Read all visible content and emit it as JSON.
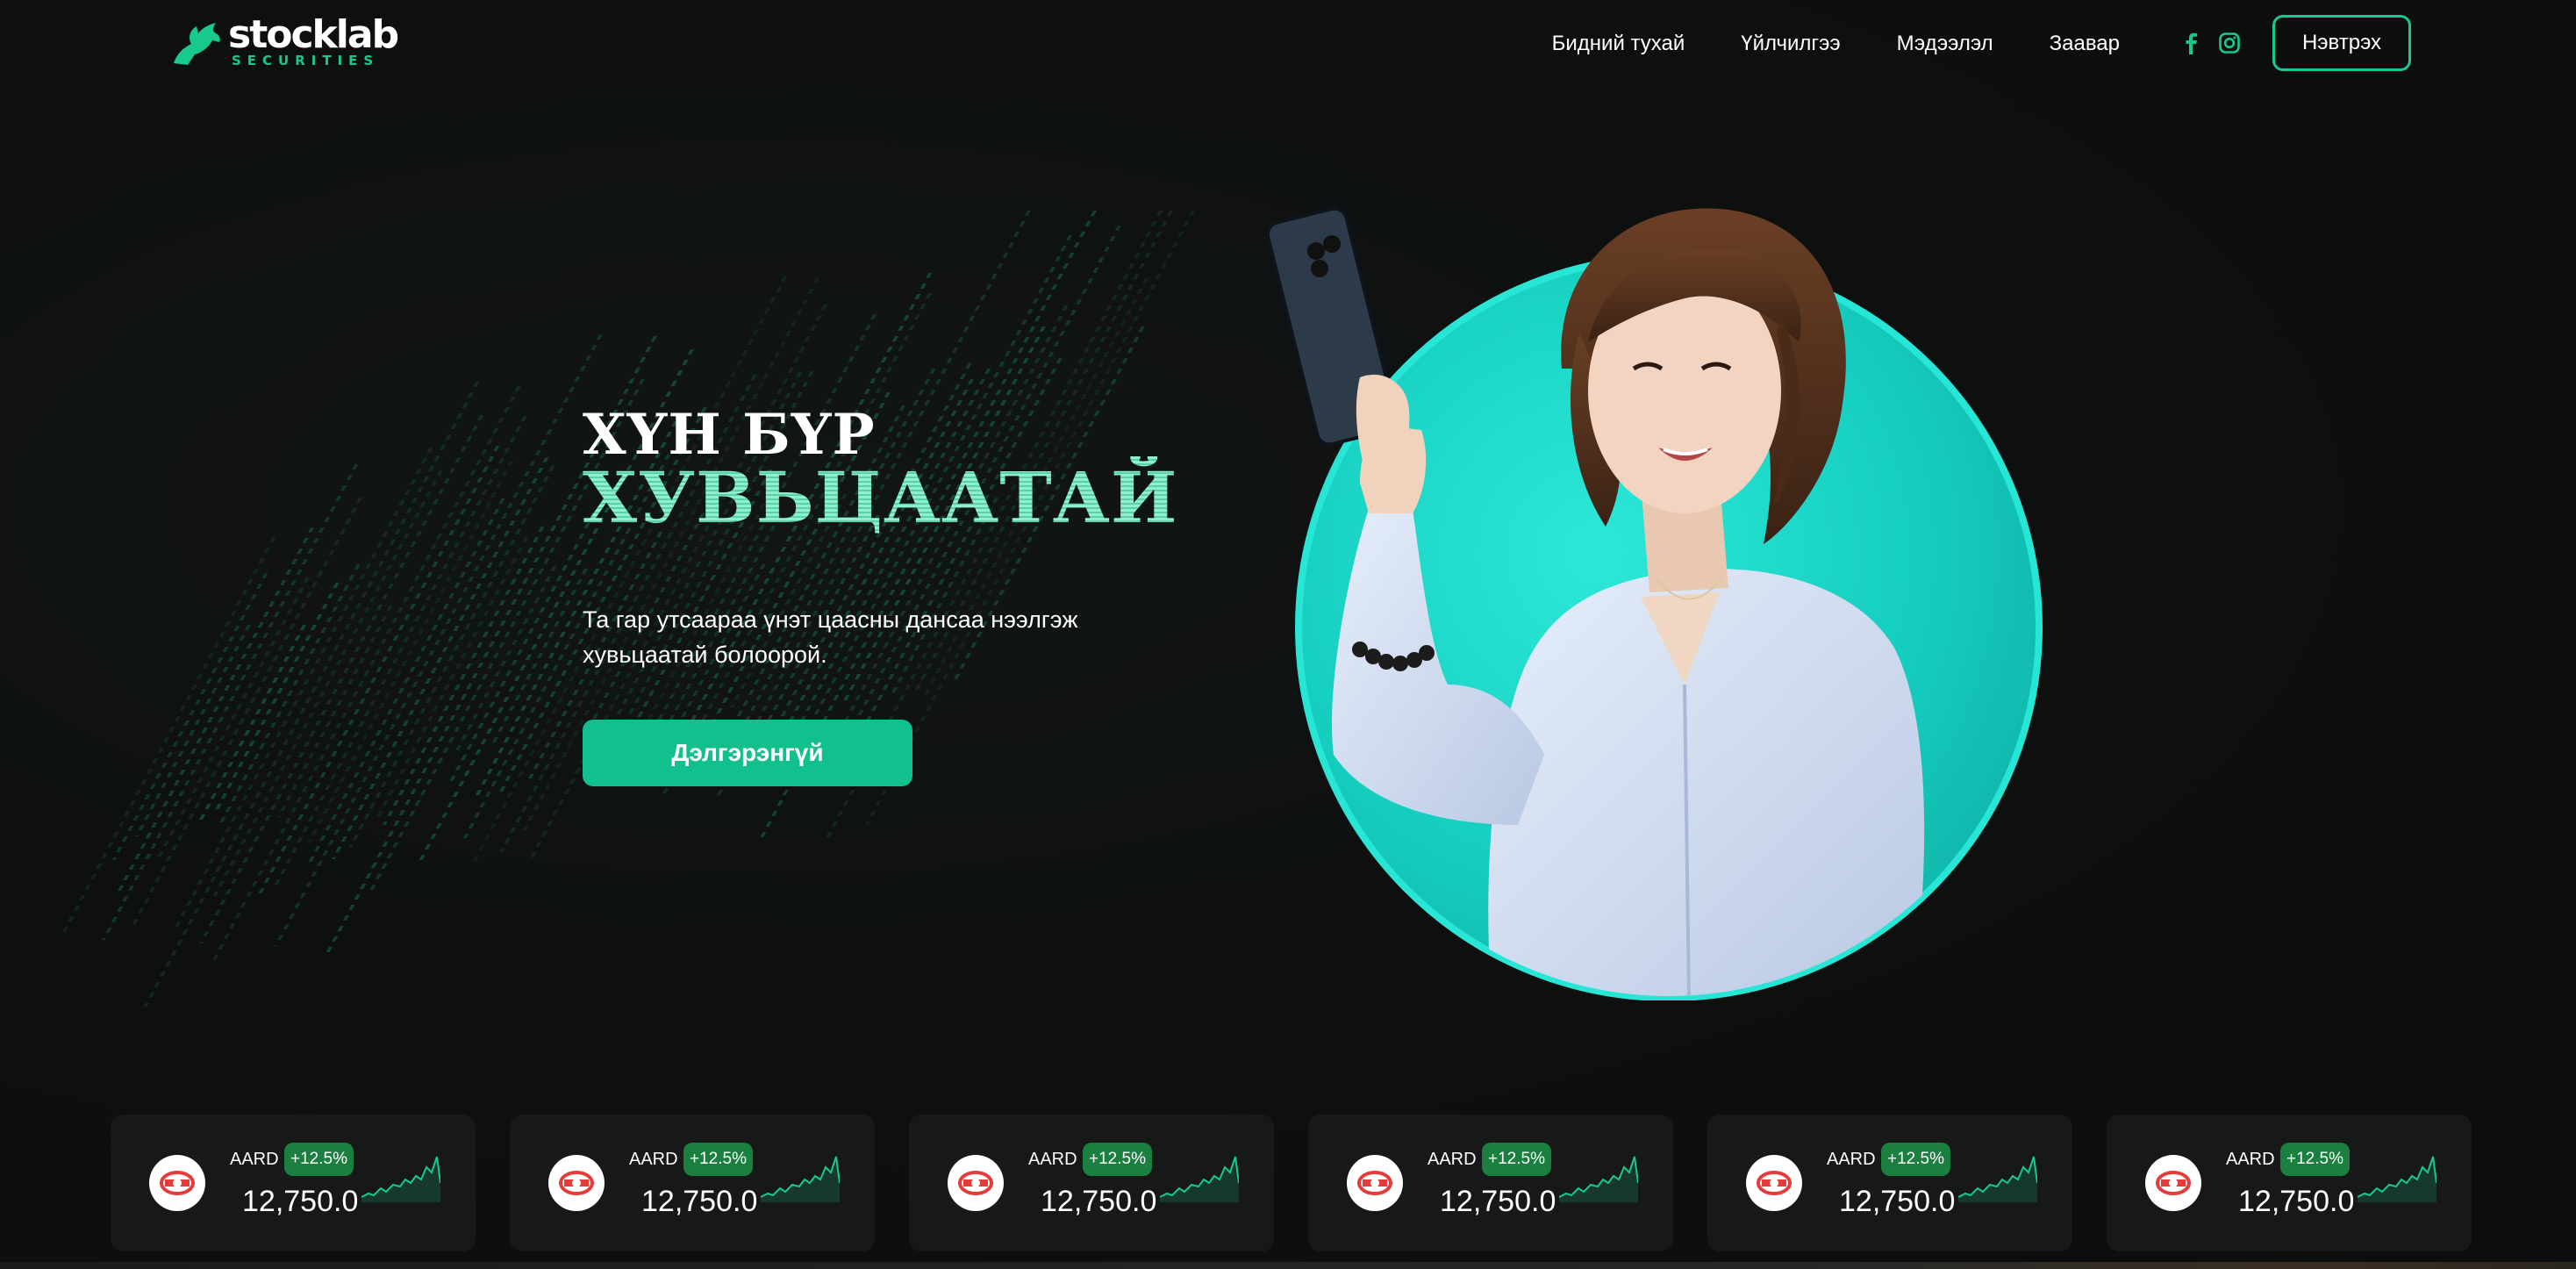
{
  "brand": {
    "name": "stocklab",
    "tagline": "SECURITIES",
    "accent": "#17c98f"
  },
  "nav": {
    "items": [
      "Бидний тухай",
      "Үйлчилгээ",
      "Мэдээлэл",
      "Заавар"
    ],
    "social": [
      "facebook-icon",
      "instagram-icon"
    ],
    "login_label": "Нэвтрэх"
  },
  "hero": {
    "headline_line1": "ХҮН БҮР",
    "headline_line2": "ХУВЬЦААТАЙ",
    "subtext": "Та гар утсаараа үнэт цаасны дансаа нээлгэж хувьцаатай болоорой.",
    "cta_label": "Дэлгэрэнгүй"
  },
  "ticker": [
    {
      "symbol": "AARD",
      "change": "+12.5%",
      "price": "12,750.0"
    },
    {
      "symbol": "AARD",
      "change": "+12.5%",
      "price": "12,750.0"
    },
    {
      "symbol": "AARD",
      "change": "+12.5%",
      "price": "12,750.0"
    },
    {
      "symbol": "AARD",
      "change": "+12.5%",
      "price": "12,750.0"
    },
    {
      "symbol": "AARD",
      "change": "+12.5%",
      "price": "12,750.0"
    },
    {
      "symbol": "AARD",
      "change": "+12.5%",
      "price": "12,750.0"
    }
  ],
  "colors": {
    "background": "#0d0f0f",
    "card": "#171919",
    "cta": "#12c08e",
    "badge": "#1a7f3f",
    "headline_accent": "#7ce6c5",
    "circle": "#1fd6c4"
  }
}
